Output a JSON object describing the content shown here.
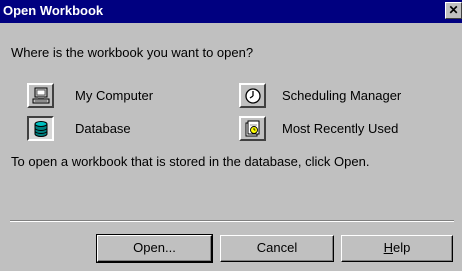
{
  "window": {
    "title": "Open Workbook",
    "close_glyph": "✕"
  },
  "prompt": "Where is the workbook you want to open?",
  "options": [
    {
      "label": "My Computer",
      "icon": "computer-icon",
      "selected": false
    },
    {
      "label": "Database",
      "icon": "database-icon",
      "selected": true
    },
    {
      "label": "Scheduling Manager",
      "icon": "clock-icon",
      "selected": false
    },
    {
      "label": "Most Recently Used",
      "icon": "recent-files-icon",
      "selected": false
    }
  ],
  "info": "To open a workbook that is stored in the database, click Open.",
  "buttons": {
    "open": "Open...",
    "cancel": "Cancel",
    "help": "Help"
  }
}
